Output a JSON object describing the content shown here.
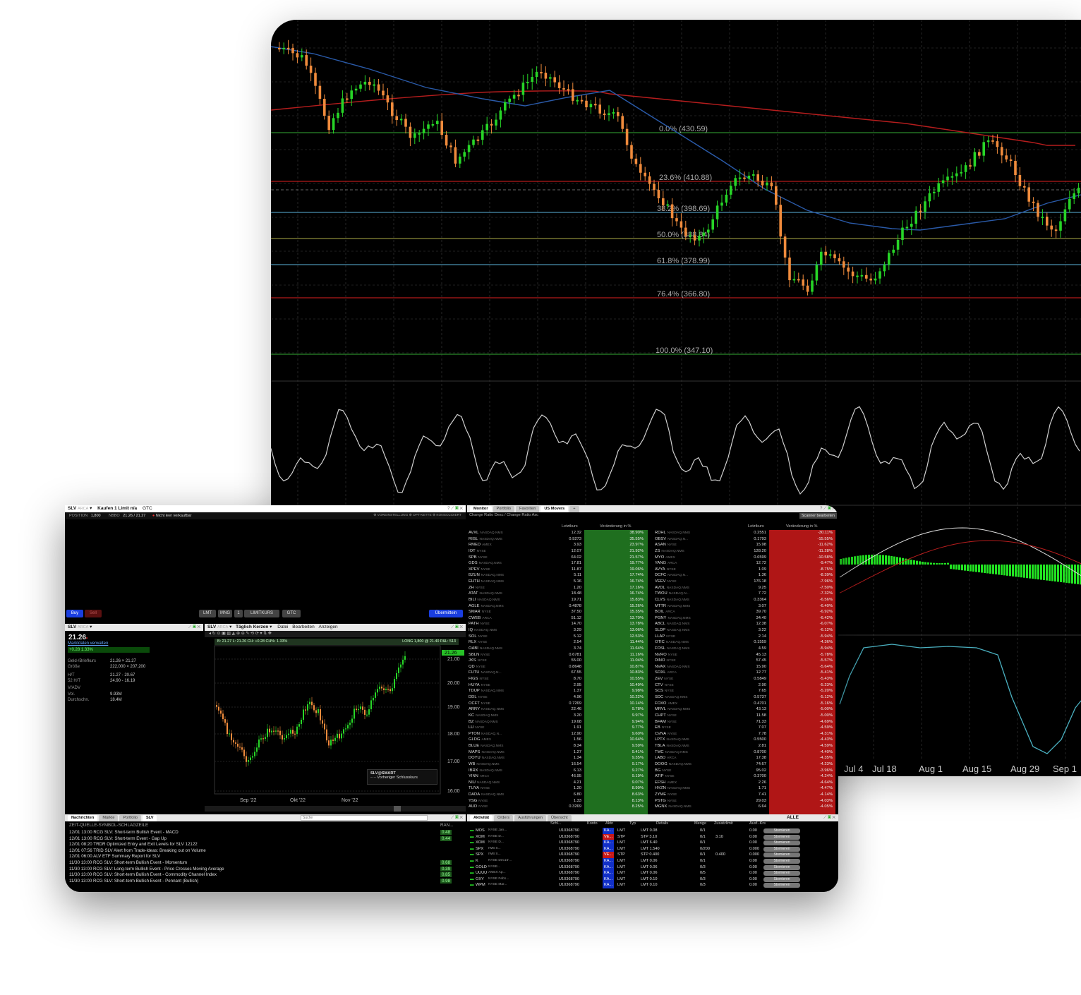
{
  "main_chart": {
    "fib_levels": [
      {
        "label": "0.0% (430.59)",
        "color": "#2a8a2a"
      },
      {
        "label": "23.6% (410.88)",
        "color": "#b31b1b"
      },
      {
        "label": "38.2% (398.69)",
        "color": "#4a8fb0"
      },
      {
        "label": "50.0% (388.84)",
        "color": "#8a8a3a"
      },
      {
        "label": "61.8% (378.99)",
        "color": "#4a8fb0"
      },
      {
        "label": "76.4% (366.80)",
        "color": "#b31b1b"
      },
      {
        "label": "100.0% (347.10)",
        "color": "#2a8a2a"
      }
    ],
    "x_labels": [
      "Jul 4",
      "Jul 18",
      "Aug 1",
      "Aug 15",
      "Aug 29",
      "Sep 1"
    ]
  },
  "order_entry": {
    "symbol": "SLV",
    "exchange": "ARCA",
    "order_desc": "Kaufen 1 Limit n/a",
    "tif": "GTC",
    "position_label": "POSITION",
    "position": "1,800",
    "nbbo_label": "NBBO",
    "nbbo": "21.26 / 21.27",
    "warning": "Nicht leer verkaufbar",
    "options": [
      "VOREINSTELLUNG",
      "OPT-KETTE",
      "KONSOLIDIERT"
    ],
    "buy": "Buy",
    "sell": "Sell",
    "type": "LMT",
    "route": "MNG",
    "qty": "1",
    "limit": "LIMITKURS",
    "tif_btn": "GTC",
    "submit": "Übermitteln"
  },
  "quote": {
    "symbol": "SLV",
    "exchange": "ARCA",
    "last": "21.26",
    "mgmt": "Marktdaten verwalten",
    "change": "+0.28  1.33%",
    "rows": [
      {
        "k": "Geld-/Briefkurs",
        "v": "21.26 × 21.27"
      },
      {
        "k": "Größe",
        "v": "222,000 × 207,200"
      },
      {
        "k": "H/T",
        "v": "21.27 - 20.67"
      },
      {
        "k": "52 H/T",
        "v": "24.90 - 16.19"
      },
      {
        "k": "V/ADV",
        "v": ""
      },
      {
        "k": "Vol.",
        "v": "9.93M"
      },
      {
        "k": "Durchschn.",
        "v": "18.4M"
      }
    ]
  },
  "mini_chart": {
    "symbol": "SLV",
    "exchange": "ARCA",
    "interval": "Täglich Kerzen",
    "menus": [
      "Datei",
      "Bearbeiten",
      "Anzeigen"
    ],
    "info": "B: 21.27  L: 21.26  CH: +0.28  CH%: 1.33%",
    "position": "LONG 1,800 @ 21.40  P&L: 513",
    "last_tag": "21.26",
    "y_labels": [
      "21.00",
      "20.00",
      "19.00",
      "18.00",
      "17.00",
      "16.00"
    ],
    "x_labels": [
      "Sep '22",
      "Okt '22",
      "Nov '22"
    ],
    "legend_title": "SLV@SMART",
    "legend_sub": "Vorheriger Schlusskurs"
  },
  "monitor": {
    "tabs": [
      "Monitor",
      "Portfolio",
      "Favoriten",
      "US Movers"
    ],
    "subtitle": "Change Ratio Desc / Change Ratio Asc",
    "scanner_btn": "Scanner bearbeiten",
    "col_last": "Letztkurs",
    "col_change": "Veränderung in %",
    "gainers": [
      [
        "AVXL",
        "NASDAQ.NMS",
        "12.32",
        "38.90%"
      ],
      [
        "RIGL",
        "NASDAQ.NMS",
        "0.9273",
        "35.55%"
      ],
      [
        "RMED",
        "AMEX",
        "3.93",
        "23.97%"
      ],
      [
        "IOT",
        "NYSE",
        "12.07",
        "21.92%"
      ],
      [
        "SPB",
        "NYSE",
        "64.02",
        "21.57%"
      ],
      [
        "GDS",
        "NASDAQ.NMS",
        "17.81",
        "19.77%"
      ],
      [
        "XPEV",
        "NYSE",
        "11.87",
        "19.06%"
      ],
      [
        "BZUN",
        "NASDAQ.NMS",
        "5.11",
        "17.74%"
      ],
      [
        "EHTH",
        "NASDAQ.NMS",
        "5.16",
        "16.74%"
      ],
      [
        "ZH",
        "NYSE",
        "1.20",
        "17.16%"
      ],
      [
        "ATAT",
        "NASDAQ.NMS",
        "18.48",
        "16.74%"
      ],
      [
        "BILI",
        "NASDAQ.NMS",
        "19.71",
        "15.83%"
      ],
      [
        "AGLE",
        "NASDAQ.NMS",
        "0.4878",
        "15.26%"
      ],
      [
        "SMAR",
        "NYSE",
        "37.50",
        "15.35%"
      ],
      [
        "CWEB",
        "ARCA",
        "51.12",
        "13.70%"
      ],
      [
        "PATH",
        "NYSE",
        "14.70",
        "13.78%"
      ],
      [
        "IQ",
        "NASDAQ.NMS",
        "3.29",
        "13.06%"
      ],
      [
        "SOL",
        "NYSE",
        "5.12",
        "12.53%"
      ],
      [
        "RLX",
        "NYSE",
        "2.54",
        "11.44%"
      ],
      [
        "OABI",
        "NASDAQ.NMS",
        "3.74",
        "11.64%"
      ],
      [
        "SBLN",
        "NYSE",
        "0.6781",
        "11.16%"
      ],
      [
        "JKS",
        "NYSE",
        "55.00",
        "11.04%"
      ],
      [
        "QD",
        "NYSE",
        "0.8648",
        "10.87%"
      ],
      [
        "FUTU",
        "NASDAQ.N...",
        "67.55",
        "10.83%"
      ],
      [
        "FIGS",
        "NYSE",
        "8.70",
        "10.55%"
      ],
      [
        "HUYA",
        "NYSE",
        "2.95",
        "10.49%"
      ],
      [
        "TDUP",
        "NASDAQ.NMS",
        "1.37",
        "9.98%"
      ],
      [
        "DDL",
        "NYSE",
        "4.96",
        "10.22%"
      ],
      [
        "OCFT",
        "NYSE",
        "0.7269",
        "10.14%"
      ],
      [
        "ARRY",
        "NASDAQ.NMS",
        "22.46",
        "9.78%"
      ],
      [
        "KC",
        "NASDAQ.NMS",
        "3.20",
        "9.97%"
      ],
      [
        "BZ",
        "NASDAQ.NMS",
        "19.68",
        "9.94%"
      ],
      [
        "LU",
        "NYSE",
        "1.91",
        "9.77%"
      ],
      [
        "PTON",
        "NASDAQ.N...",
        "12.90",
        "9.60%"
      ],
      [
        "GLDG",
        "AMEX",
        "1.56",
        "10.64%"
      ],
      [
        "BLUE",
        "NASDAQ.NMS",
        "8.34",
        "9.59%"
      ],
      [
        "MAPS",
        "NASDAQ.NMS",
        "1.27",
        "9.41%"
      ],
      [
        "DOYU",
        "NASDAQ.NMS",
        "1.34",
        "9.35%"
      ],
      [
        "WB",
        "NASDAQ.NMS",
        "16.54",
        "9.17%"
      ],
      [
        "IBRX",
        "NASDAQ.NMS",
        "6.13",
        "9.27%"
      ],
      [
        "YINN",
        "ARCA",
        "46.95",
        "9.19%"
      ],
      [
        "NIU",
        "NASDAQ.NMS",
        "4.21",
        "9.07%"
      ],
      [
        "TUYA",
        "NYSE",
        "1.20",
        "8.99%"
      ],
      [
        "DADA",
        "NASDAQ.NMS",
        "6.80",
        "8.63%"
      ],
      [
        "YSG",
        "NYSE",
        "1.33",
        "8.13%"
      ],
      [
        "AUD",
        "NYSE",
        "0.3269",
        "8.25%"
      ]
    ],
    "losers": [
      [
        "RDHL",
        "NASDAQ.NMS",
        "0.2551",
        "-30.11%"
      ],
      [
        "OBSV",
        "NASDAQ.N...",
        "0.1793",
        "-15.55%"
      ],
      [
        "ASAN",
        "NYSE",
        "15.98",
        "-11.62%"
      ],
      [
        "ZS",
        "NASDAQ.NMS",
        "128.20",
        "-11.28%"
      ],
      [
        "MYO",
        "AMEX",
        "0.6599",
        "-10.58%"
      ],
      [
        "YANG",
        "ARCA",
        "12.72",
        "-9.47%"
      ],
      [
        "AVYA",
        "NYSE",
        "1.09",
        "-8.75%"
      ],
      [
        "DCFC",
        "NASDAQ.N...",
        "1.36",
        "-8.39%"
      ],
      [
        "VEEV",
        "NYSE",
        "176.18",
        "-7.96%"
      ],
      [
        "AVDL",
        "NASDAQ.NMS",
        "9.25",
        "-7.50%"
      ],
      [
        "TWOU",
        "NASDAQ.N...",
        "7.72",
        "-7.32%"
      ],
      [
        "CLVS",
        "NASDAQ.NMS",
        "0.3364",
        "-6.56%"
      ],
      [
        "MTTR",
        "NASDAQ.NMS",
        "3.07",
        "-6.40%"
      ],
      [
        "BOIL",
        "ARCA",
        "39.70",
        "-6.92%"
      ],
      [
        "PGNY",
        "NASDAQ.NMS",
        "34.40",
        "-6.42%"
      ],
      [
        "ABCL",
        "NASDAQ.NMS",
        "12.38",
        "-6.07%"
      ],
      [
        "SLDP",
        "NASDAQ.NMS",
        "3.22",
        "-6.12%"
      ],
      [
        "LLAP",
        "NYSE",
        "2.14",
        "-5.94%"
      ],
      [
        "OTIC",
        "NASDAQ.NMS",
        "0.1559",
        "-4.36%"
      ],
      [
        "FOSL",
        "NASDAQ.NMS",
        "4.59",
        "-5.94%"
      ],
      [
        "NVRO",
        "NYSE",
        "45.13",
        "-5.78%"
      ],
      [
        "DINO",
        "NYSE",
        "57.45",
        "-5.57%"
      ],
      [
        "NVAX",
        "NASDAQ.NMS",
        "15.90",
        "-5.64%"
      ],
      [
        "SOXL",
        "ARCA",
        "12.77",
        "-5.41%"
      ],
      [
        "ZEV",
        "NYSE",
        "0.5849",
        "-5.43%"
      ],
      [
        "CTV",
        "NYSE",
        "2.90",
        "-5.23%"
      ],
      [
        "SCS",
        "NYSE",
        "7.65",
        "-5.20%"
      ],
      [
        "SDC",
        "NASDAQ.NMS",
        "0.5737",
        "-5.12%"
      ],
      [
        "FOXO",
        "AMEX",
        "0.4701",
        "-5.16%"
      ],
      [
        "MRVL",
        "NASDAQ.NMS",
        "43.13",
        "-5.00%"
      ],
      [
        "CHPT",
        "NYSE",
        "11.58",
        "-5.00%"
      ],
      [
        "BFAM",
        "NYSE",
        "71.33",
        "-4.69%"
      ],
      [
        "EB",
        "NYSE",
        "7.07",
        "-4.59%"
      ],
      [
        "CVNA",
        "NYSE",
        "7.78",
        "-4.31%"
      ],
      [
        "LPTX",
        "NASDAQ.NMS",
        "0.5500",
        "-4.43%"
      ],
      [
        "TBLA",
        "NASDAQ.NMS",
        "2.81",
        "-4.59%"
      ],
      [
        "TMC",
        "NASDAQ.NMS",
        "0.8700",
        "-4.40%"
      ],
      [
        "LABD",
        "ARCA",
        "17.38",
        "-4.35%"
      ],
      [
        "DOOG",
        "NASDAQ.NMS",
        "74.67",
        "-4.23%"
      ],
      [
        "BG",
        "NYSE",
        "95.02",
        "-3.96%"
      ],
      [
        "ATIP",
        "NYSE",
        "0.3700",
        "-4.24%"
      ],
      [
        "EFSH",
        "AMEX",
        "2.26",
        "-4.64%"
      ],
      [
        "HYZN",
        "NASDAQ.NMS",
        "1.71",
        "-4.47%"
      ],
      [
        "ZYME",
        "NYSE",
        "7.41",
        "-4.14%"
      ],
      [
        "PSTG",
        "NYSE",
        "29.03",
        "-4.03%"
      ],
      [
        "MGNX",
        "NASDAQ.NMS",
        "6.64",
        "-4.05%"
      ]
    ]
  },
  "news": {
    "tabs": [
      "Nachrichten",
      "Märkte",
      "Portfolio",
      "SLV"
    ],
    "search_placeholder": "Suche",
    "header": "ZEIT-QUELLE-SYMBOL-SCHLAGZEILE",
    "rank_header": "RAN...",
    "items": [
      {
        "t": "12/01 13:00 RCG SLV: Short-term Bullish Event - MACD",
        "r": "0.48"
      },
      {
        "t": "12/01 13:00 RCG SLV: Short-term Event - Gap Up",
        "r": "0.44"
      },
      {
        "t": "12/01 08:20 TRDR Optimized Entry and Exit Levels for SLV 12122",
        "r": ""
      },
      {
        "t": "12/01 07:56 TRID SLV Alert from Trade-Ideas: Breaking out on Volume",
        "r": ""
      },
      {
        "t": "12/01 06:00 ALV ETF Summary Report for SLV",
        "r": ""
      },
      {
        "t": "11/30 13:00 RCG SLV: Short-term Bullish Event - Momentum",
        "r": "0.68"
      },
      {
        "t": "11/30 13:00 RCG SLV: Long-term Bullish Event - Price Crosses Moving Average",
        "r": "0.39"
      },
      {
        "t": "11/30 13:00 RCG SLV: Short-term Bullish Event - Commodity Channel Index",
        "r": "0.85"
      },
      {
        "t": "11/30 13:00 RCG SLV: Short-term Bullish Event - Pennant (Bullish)",
        "r": "0.98"
      }
    ]
  },
  "activity": {
    "tabs": [
      "Aktivität",
      "Orders",
      "Ausführungen",
      "Übersicht"
    ],
    "filter": "ALLE",
    "headers": [
      "Schl...",
      "Konto",
      "Aktn",
      "Typ",
      "Details",
      "Menge",
      "Zusatzlimit",
      "Ausf.-Krs"
    ],
    "cancel": "Stornieren",
    "rows": [
      {
        "sym": "MOS",
        "ex": "NYSE Jan...",
        "acct": "U10368790",
        "act": "KA...",
        "ac": "#1230c8",
        "type": "LMT",
        "det": "LMT 0.08",
        "qty": "0/1",
        "aux": "",
        "fill": "0.00"
      },
      {
        "sym": "XOM",
        "ex": "NYSE D...",
        "acct": "U10368790",
        "act": "VE...",
        "ac": "#c81818",
        "type": "STP",
        "det": "STP 3.10",
        "qty": "0/1",
        "aux": "3.10",
        "fill": "0.00"
      },
      {
        "sym": "XOM",
        "ex": "NYSE D...",
        "acct": "U10368790",
        "act": "KA...",
        "ac": "#1230c8",
        "type": "LMT",
        "det": "LMT 6.40",
        "qty": "0/1",
        "aux": "",
        "fill": "0.00"
      },
      {
        "sym": "SPX",
        "ex": "IWB S...",
        "acct": "U10368790",
        "act": "KA...",
        "ac": "#1230c8",
        "type": "LMT",
        "det": "LMT 1.540",
        "qty": "0/200",
        "aux": "",
        "fill": "0.000"
      },
      {
        "sym": "SPX",
        "ex": "IWB S...",
        "acct": "U10368790",
        "act": "VE...",
        "ac": "#c81818",
        "type": "STP",
        "det": "STP 0.400",
        "qty": "0/1",
        "aux": "0.400",
        "fill": "0.000"
      },
      {
        "sym": "K",
        "ex": "NYSE Dec16'...",
        "acct": "U10368790",
        "act": "KA...",
        "ac": "#1230c8",
        "type": "LMT",
        "det": "LMT 0.06",
        "qty": "0/1",
        "aux": "",
        "fill": "0.00"
      },
      {
        "sym": "GOLD",
        "ex": "NYSE...",
        "acct": "U10368790",
        "act": "KA...",
        "ac": "#1230c8",
        "type": "LMT",
        "det": "LMT 0.06",
        "qty": "0/3",
        "aux": "",
        "fill": "0.00"
      },
      {
        "sym": "UUUU",
        "ex": "AMEX Ap...",
        "acct": "U10368790",
        "act": "KA...",
        "ac": "#1230c8",
        "type": "LMT",
        "det": "LMT 0.06",
        "qty": "0/5",
        "aux": "",
        "fill": "0.00"
      },
      {
        "sym": "OXY",
        "ex": "NYSE Feb1...",
        "acct": "U10368790",
        "act": "KA...",
        "ac": "#1230c8",
        "type": "LMT",
        "det": "LMT 0.10",
        "qty": "0/3",
        "aux": "",
        "fill": "0.00"
      },
      {
        "sym": "WPM",
        "ex": "NYSE Mar...",
        "acct": "U10368790",
        "act": "KA...",
        "ac": "#1230c8",
        "type": "LMT",
        "det": "LMT 0.10",
        "qty": "0/3",
        "aux": "",
        "fill": "0.00"
      }
    ]
  }
}
